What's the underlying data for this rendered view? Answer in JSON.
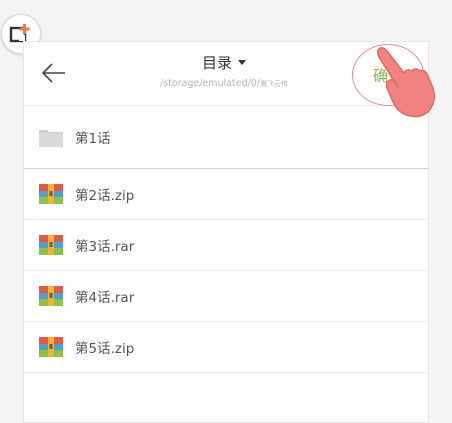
{
  "header": {
    "title": "目录",
    "path": "/storage/emulated/0/",
    "path_suffix": "鹰飞云传",
    "confirm_label": "确认"
  },
  "items": [
    {
      "label": "第1话",
      "type": "folder",
      "icon": "folder-icon"
    },
    {
      "label": "第2话.zip",
      "type": "archive",
      "icon": "archive-icon"
    },
    {
      "label": "第3话.rar",
      "type": "archive",
      "icon": "archive-icon"
    },
    {
      "label": "第4话.rar",
      "type": "archive",
      "icon": "archive-icon"
    },
    {
      "label": "第5话.zip",
      "type": "archive",
      "icon": "archive-icon"
    }
  ],
  "colors": {
    "confirm_text": "#7fbf5a",
    "highlight_ring": "#ee8b8b",
    "hand": "#f0837f",
    "app_icon_accent": "#f07a3a"
  }
}
